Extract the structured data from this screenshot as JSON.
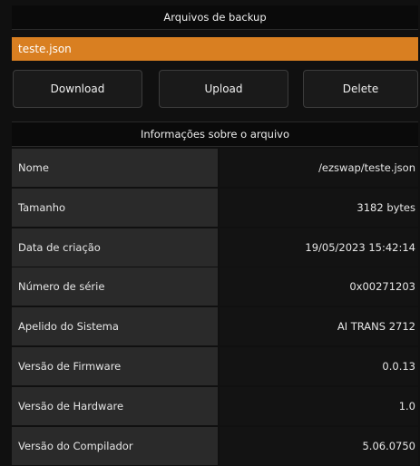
{
  "header": {
    "title": "Arquivos de backup"
  },
  "files": {
    "selected": "teste.json"
  },
  "actions": {
    "download": "Download",
    "upload": "Upload",
    "delete": "Delete"
  },
  "info": {
    "title": "Informações sobre o arquivo",
    "rows": [
      {
        "label": "Nome",
        "value": "/ezswap/teste.json"
      },
      {
        "label": "Tamanho",
        "value": "3182 bytes"
      },
      {
        "label": "Data de criação",
        "value": "19/05/2023 15:42:14"
      },
      {
        "label": "Número de série",
        "value": "0x00271203"
      },
      {
        "label": "Apelido do Sistema",
        "value": "AI TRANS 2712"
      },
      {
        "label": "Versão de Firmware",
        "value": "0.0.13"
      },
      {
        "label": "Versão de Hardware",
        "value": "1.0"
      },
      {
        "label": "Versão do Compilador",
        "value": "5.06.0750"
      }
    ]
  },
  "colors": {
    "accent": "#d97f21",
    "background": "#101010",
    "label_cell": "#2a2a2a",
    "value_cell": "#131313"
  }
}
